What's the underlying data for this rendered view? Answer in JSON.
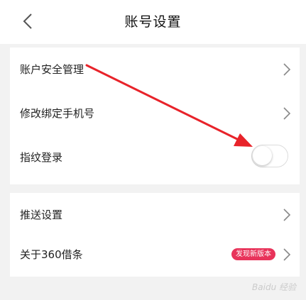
{
  "header": {
    "title": "账号设置"
  },
  "icons": {
    "back": "chevron-left-icon",
    "row_arrow": "chevron-right-icon"
  },
  "group1": {
    "items": [
      {
        "label": "账户安全管理"
      },
      {
        "label": "修改绑定手机号"
      },
      {
        "label": "指纹登录",
        "toggle_on": false
      }
    ]
  },
  "group2": {
    "items": [
      {
        "label": "推送设置"
      },
      {
        "label": "关于360借条",
        "badge": "发现新版本"
      }
    ]
  },
  "annotation": {
    "arrow_color": "#e8232a"
  },
  "watermark": {
    "text": "Baidu 经验"
  }
}
